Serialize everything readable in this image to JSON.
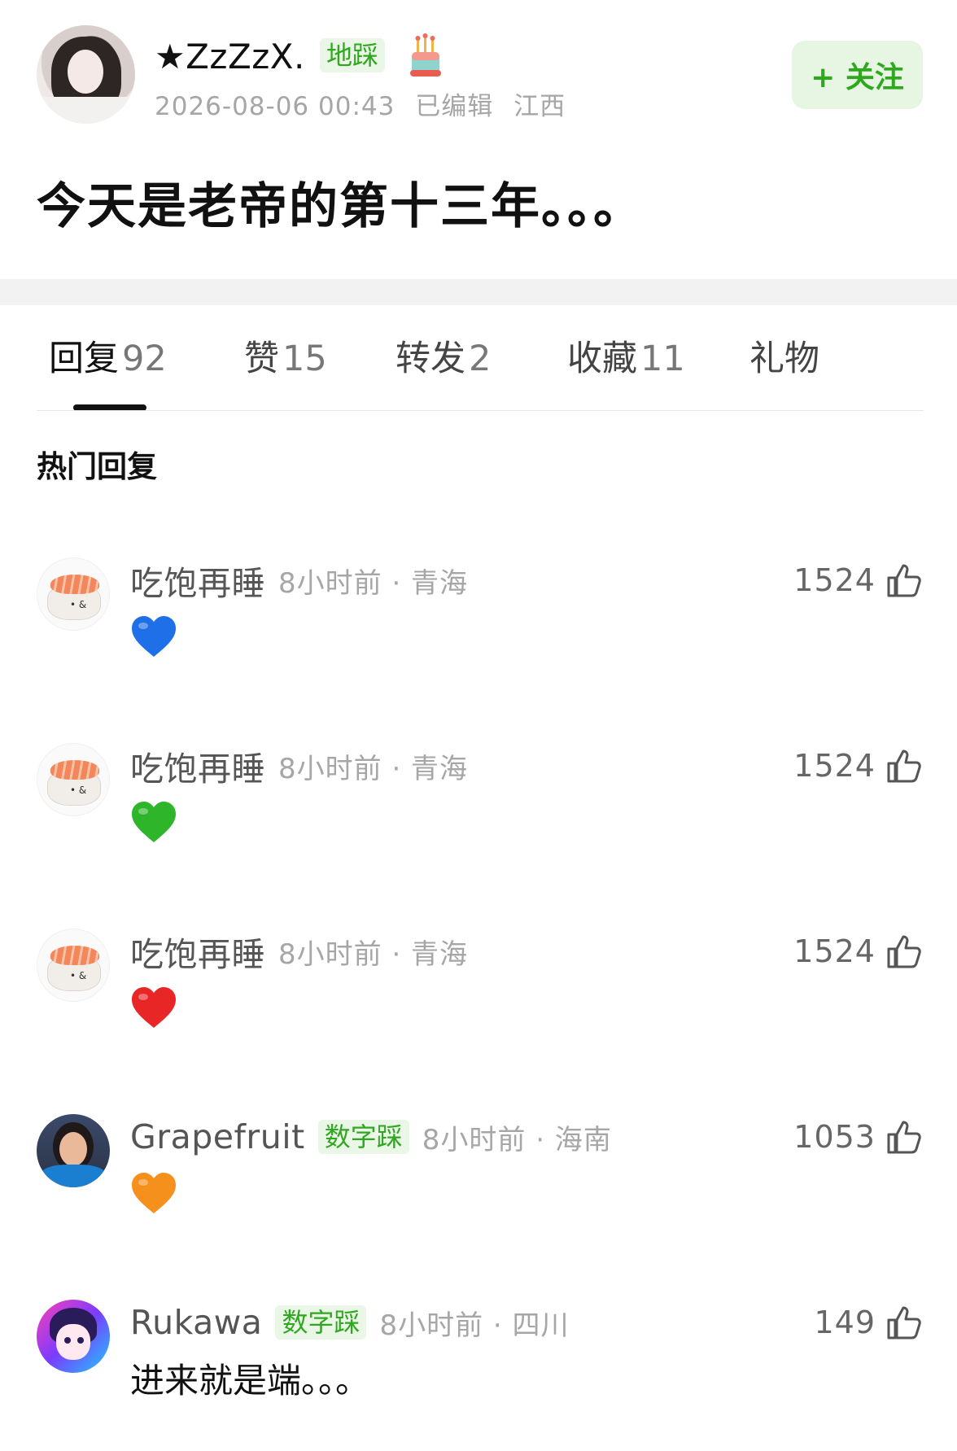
{
  "post": {
    "author_name": "★ZzZzX.",
    "author_tag": "地踩",
    "date": "2026-08-06 00:43",
    "edited": "已编辑",
    "location": "江西",
    "follow_label": "+ 关注",
    "content": "今天是老帝的第十三年。。。"
  },
  "tabs": [
    {
      "label": "回复",
      "count": "92"
    },
    {
      "label": "赞",
      "count": "15"
    },
    {
      "label": "转发",
      "count": "2"
    },
    {
      "label": "收藏",
      "count": "11"
    },
    {
      "label": "礼物",
      "count": ""
    }
  ],
  "section_title": "热门回复",
  "comments": [
    {
      "name": "吃饱再睡",
      "badge": "",
      "meta": "8小时前 · 青海",
      "likes": "1524",
      "text": "",
      "heart_color": "#1e6fe8",
      "avatar": "sushi-avatar"
    },
    {
      "name": "吃饱再睡",
      "badge": "",
      "meta": "8小时前 · 青海",
      "likes": "1524",
      "text": "",
      "heart_color": "#2fb52a",
      "avatar": "sushi-avatar"
    },
    {
      "name": "吃饱再睡",
      "badge": "",
      "meta": "8小时前 · 青海",
      "likes": "1524",
      "text": "",
      "heart_color": "#e82626",
      "avatar": "sushi-avatar"
    },
    {
      "name": "Grapefruit",
      "badge": "数字踩",
      "meta": "8小时前 · 海南",
      "likes": "1053",
      "text": "",
      "heart_color": "#f5901c",
      "avatar": "girl-avatar"
    },
    {
      "name": "Rukawa",
      "badge": "数字踩",
      "meta": "8小时前 · 四川",
      "likes": "149",
      "text": "进来就是端。。。",
      "heart_color": "",
      "avatar": "anime-avatar"
    }
  ],
  "colors": {
    "accent_green": "#2fa820",
    "follow_bg": "#e6f6e3",
    "meta_gray": "#a6a6a6"
  }
}
